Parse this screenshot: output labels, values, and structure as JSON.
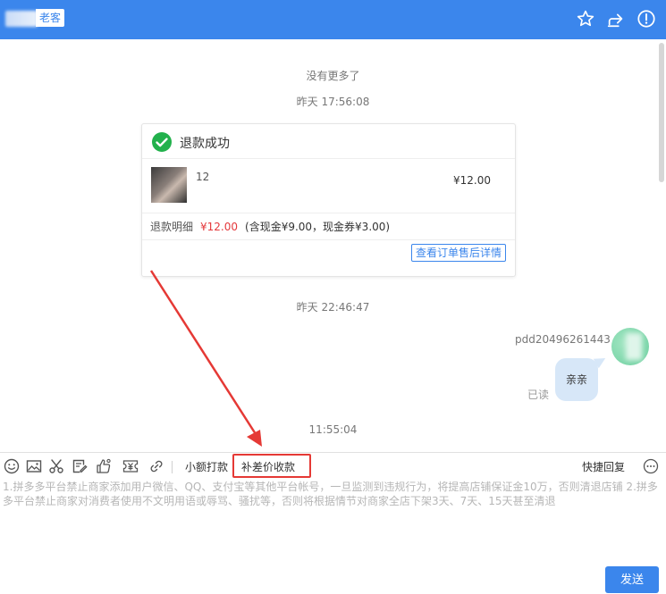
{
  "header": {
    "tag": "老客",
    "icons": [
      "star-icon",
      "share-icon",
      "warning-icon"
    ]
  },
  "messages": {
    "no_more": "没有更多了",
    "time1": "昨天 17:56:08",
    "time2": "昨天 22:46:47",
    "time3": "11:55:04"
  },
  "refund_card": {
    "title": "退款成功",
    "product_name": "12",
    "product_price": "¥12.00",
    "detail_label": "退款明细",
    "detail_amount": "¥12.00",
    "detail_note": "(含现金¥9.00，现金券¥3.00)",
    "detail_button": "查看订单售后详情"
  },
  "chat": {
    "sender": "pdd20496261443",
    "read_status": "已读",
    "bubble": "亲亲"
  },
  "toolbar": {
    "small_payment": "小额打款",
    "price_diff": "补差价收款",
    "quick_reply": "快捷回复"
  },
  "input": {
    "placeholder": "1.拼多多平台禁止商家添加用户微信、QQ、支付宝等其他平台帐号，一旦监测到违规行为，将提高店铺保证金10万，否则清退店铺  2.拼多多平台禁止商家对消费者使用不文明用语或辱骂、骚扰等，否则将根据情节对商家全店下架3天、7天、15天甚至清退"
  },
  "send_label": "发送",
  "colors": {
    "brand": "#3b86ec",
    "success": "#22b14c",
    "price_red": "#e4393c",
    "highlight": "#e53935"
  }
}
